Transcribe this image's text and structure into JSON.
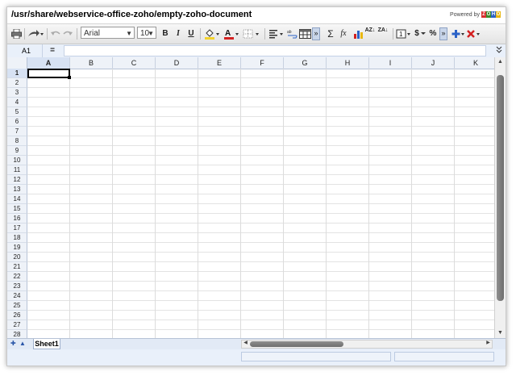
{
  "window": {
    "title": "/usr/share/webservice-office-zoho/empty-zoho-document",
    "powered_by": "Powered by",
    "logo_letters": [
      "Z",
      "O",
      "H",
      "O"
    ],
    "logo_colors": [
      "#d62e2e",
      "#3a8d2c",
      "#2b62c7",
      "#e8b812"
    ]
  },
  "toolbar": {
    "font_name": "Arial",
    "font_size": "10",
    "bold": "B",
    "italic": "I",
    "underline": "U",
    "sum": "Σ",
    "fx": "fx",
    "currency": "$",
    "percent": "%",
    "more": "»",
    "sort_asc": "AZ↓",
    "sort_desc": "ZA↓",
    "text_color": "#d32020",
    "fill_color": "#f3d22b"
  },
  "formula_bar": {
    "cell_ref": "A1",
    "equals": "=",
    "value": ""
  },
  "grid": {
    "columns": [
      "A",
      "B",
      "C",
      "D",
      "E",
      "F",
      "G",
      "H",
      "I",
      "J",
      "K"
    ],
    "rows": [
      "1",
      "2",
      "3",
      "4",
      "5",
      "6",
      "7",
      "8",
      "9",
      "10",
      "11",
      "12",
      "13",
      "14",
      "15",
      "16",
      "17",
      "18",
      "19",
      "20",
      "21",
      "22",
      "23",
      "24",
      "25",
      "26",
      "27",
      "28"
    ],
    "active_cell": "A1"
  },
  "sheets": {
    "tabs": [
      "Sheet1"
    ],
    "active": "Sheet1"
  }
}
